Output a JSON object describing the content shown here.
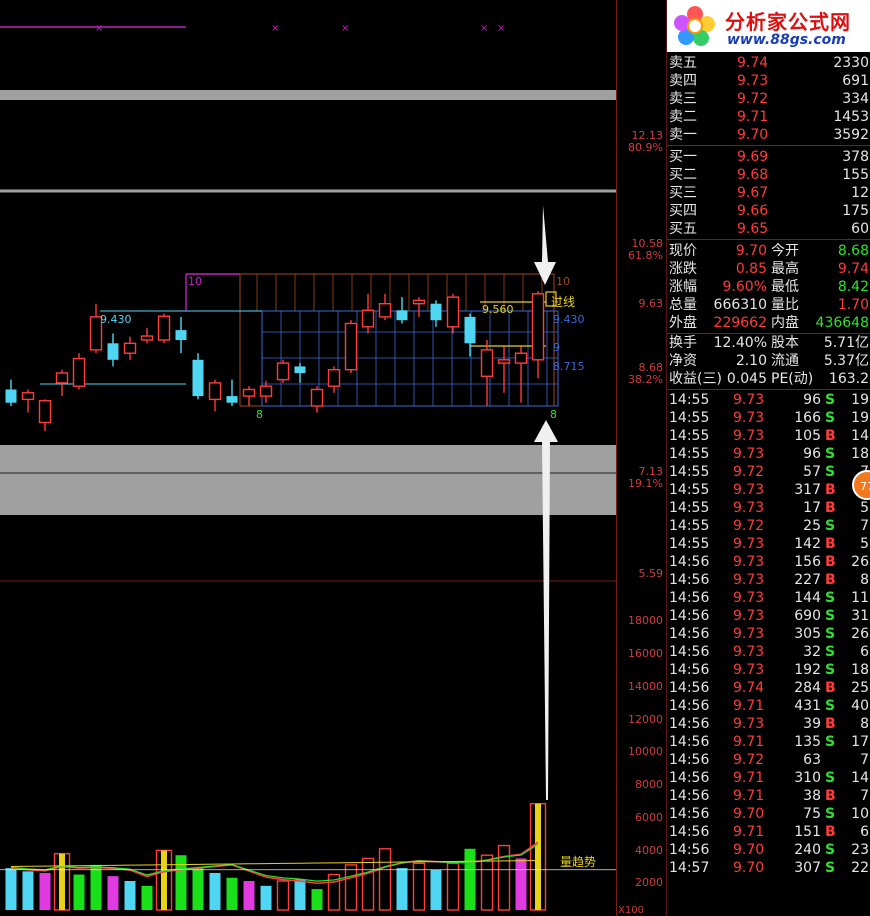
{
  "logo": {
    "brand": "分析家公式网",
    "url": "www.88gs.com"
  },
  "colors": {
    "up": "#ff3b3b",
    "down": "#4fd6f2",
    "grid": "#8a2a2a",
    "green_bar": "#19e019",
    "magenta_bar": "#e03ae0"
  },
  "price_axis": [
    {
      "value": "12.13",
      "pct": "80.9%"
    },
    {
      "value": "10.58",
      "pct": "61.8%"
    },
    {
      "value": "9.63",
      "pct": ""
    },
    {
      "value": "8.68",
      "pct": "38.2%"
    },
    {
      "value": "7.13",
      "pct": "19.1%"
    },
    {
      "value": "5.59",
      "pct": ""
    }
  ],
  "volume_axis": [
    "18000",
    "16000",
    "14000",
    "12000",
    "10000",
    "8000",
    "6000",
    "4000",
    "2000"
  ],
  "volume_unit": "X100",
  "annotations": {
    "box_top": "10",
    "box_bottom": "8",
    "level_9430": "9.430",
    "level_9560": "9.560",
    "level_9430_right": "9.430",
    "level_9": "9",
    "level_8715": "8.715",
    "box_right_top": "10",
    "box_right_bottom": "8",
    "signal_text": "过线",
    "volume_trend_text": "量趋势"
  },
  "order_book": {
    "asks": [
      {
        "label": "卖五",
        "price": "9.74",
        "vol": "2330"
      },
      {
        "label": "卖四",
        "price": "9.73",
        "vol": "691"
      },
      {
        "label": "卖三",
        "price": "9.72",
        "vol": "334"
      },
      {
        "label": "卖二",
        "price": "9.71",
        "vol": "1453"
      },
      {
        "label": "卖一",
        "price": "9.70",
        "vol": "3592"
      }
    ],
    "bids": [
      {
        "label": "买一",
        "price": "9.69",
        "vol": "378"
      },
      {
        "label": "买二",
        "price": "9.68",
        "vol": "155"
      },
      {
        "label": "买三",
        "price": "9.67",
        "vol": "12"
      },
      {
        "label": "买四",
        "price": "9.66",
        "vol": "175"
      },
      {
        "label": "买五",
        "price": "9.65",
        "vol": "60"
      }
    ]
  },
  "stats": [
    {
      "l1": "现价",
      "v1": "9.70",
      "c1": "red",
      "l2": "今开",
      "v2": "8.68",
      "c2": "green"
    },
    {
      "l1": "涨跌",
      "v1": "0.85",
      "c1": "red",
      "l2": "最高",
      "v2": "9.74",
      "c2": "red"
    },
    {
      "l1": "涨幅",
      "v1": "9.60%",
      "c1": "red",
      "l2": "最低",
      "v2": "8.42",
      "c2": "green"
    },
    {
      "l1": "总量",
      "v1": "666310",
      "c1": "white",
      "l2": "量比",
      "v2": "1.70",
      "c2": "red"
    },
    {
      "l1": "外盘",
      "v1": "229662",
      "c1": "red",
      "l2": "内盘",
      "v2": "436648",
      "c2": "green"
    },
    {
      "l1": "换手",
      "v1": "12.40%",
      "c1": "white",
      "l2": "股本",
      "v2": "5.71亿",
      "c2": "white"
    },
    {
      "l1": "净资",
      "v1": "2.10",
      "c1": "white",
      "l2": "流通",
      "v2": "5.37亿",
      "c2": "white"
    },
    {
      "l1": "收益(三)",
      "v1": "0.045",
      "c1": "white",
      "l2": "PE(动)",
      "v2": "163.2",
      "c2": "white"
    }
  ],
  "ticks": [
    {
      "t": "14:55",
      "p": "9.73",
      "v": "96",
      "d": "S",
      "n": "19"
    },
    {
      "t": "14:55",
      "p": "9.73",
      "v": "166",
      "d": "S",
      "n": "19"
    },
    {
      "t": "14:55",
      "p": "9.73",
      "v": "105",
      "d": "B",
      "n": "14"
    },
    {
      "t": "14:55",
      "p": "9.73",
      "v": "96",
      "d": "S",
      "n": "18"
    },
    {
      "t": "14:55",
      "p": "9.72",
      "v": "57",
      "d": "S",
      "n": "7"
    },
    {
      "t": "14:55",
      "p": "9.73",
      "v": "317",
      "d": "B",
      "n": "5"
    },
    {
      "t": "14:55",
      "p": "9.73",
      "v": "17",
      "d": "B",
      "n": "5"
    },
    {
      "t": "14:55",
      "p": "9.72",
      "v": "25",
      "d": "S",
      "n": "7"
    },
    {
      "t": "14:55",
      "p": "9.73",
      "v": "142",
      "d": "B",
      "n": "5"
    },
    {
      "t": "14:56",
      "p": "9.73",
      "v": "156",
      "d": "B",
      "n": "26"
    },
    {
      "t": "14:56",
      "p": "9.73",
      "v": "227",
      "d": "B",
      "n": "8"
    },
    {
      "t": "14:56",
      "p": "9.73",
      "v": "144",
      "d": "S",
      "n": "11"
    },
    {
      "t": "14:56",
      "p": "9.73",
      "v": "690",
      "d": "S",
      "n": "31",
      "vc": "mag"
    },
    {
      "t": "14:56",
      "p": "9.73",
      "v": "305",
      "d": "S",
      "n": "26"
    },
    {
      "t": "14:56",
      "p": "9.73",
      "v": "32",
      "d": "S",
      "n": "6"
    },
    {
      "t": "14:56",
      "p": "9.73",
      "v": "192",
      "d": "S",
      "n": "18"
    },
    {
      "t": "14:56",
      "p": "9.74",
      "v": "284",
      "d": "B",
      "n": "25"
    },
    {
      "t": "14:56",
      "p": "9.71",
      "v": "431",
      "d": "S",
      "n": "40"
    },
    {
      "t": "14:56",
      "p": "9.73",
      "v": "39",
      "d": "B",
      "n": "8"
    },
    {
      "t": "14:56",
      "p": "9.71",
      "v": "135",
      "d": "S",
      "n": "17"
    },
    {
      "t": "14:56",
      "p": "9.72",
      "v": "63",
      "d": "",
      "n": "7"
    },
    {
      "t": "14:56",
      "p": "9.71",
      "v": "310",
      "d": "S",
      "n": "14"
    },
    {
      "t": "14:56",
      "p": "9.71",
      "v": "38",
      "d": "B",
      "n": "7"
    },
    {
      "t": "14:56",
      "p": "9.70",
      "v": "75",
      "d": "S",
      "n": "10"
    },
    {
      "t": "14:56",
      "p": "9.71",
      "v": "151",
      "d": "B",
      "n": "6"
    },
    {
      "t": "14:56",
      "p": "9.70",
      "v": "240",
      "d": "S",
      "n": "23"
    },
    {
      "t": "14:57",
      "p": "9.70",
      "v": "307",
      "d": "S",
      "n": "22"
    }
  ],
  "chart_data": {
    "type": "candlestick",
    "candles": [
      {
        "o": 8.25,
        "h": 8.4,
        "l": 8.0,
        "c": 8.05
      },
      {
        "o": 8.1,
        "h": 8.25,
        "l": 7.9,
        "c": 8.2
      },
      {
        "o": 7.75,
        "h": 8.1,
        "l": 7.62,
        "c": 8.08
      },
      {
        "o": 8.35,
        "h": 8.55,
        "l": 8.15,
        "c": 8.5
      },
      {
        "o": 8.3,
        "h": 8.8,
        "l": 8.25,
        "c": 8.72
      },
      {
        "o": 8.85,
        "h": 9.55,
        "l": 8.8,
        "c": 9.35
      },
      {
        "o": 8.95,
        "h": 9.1,
        "l": 8.6,
        "c": 8.7
      },
      {
        "o": 8.8,
        "h": 9.05,
        "l": 8.7,
        "c": 8.95
      },
      {
        "o": 9.0,
        "h": 9.18,
        "l": 8.95,
        "c": 9.06
      },
      {
        "o": 9.0,
        "h": 9.4,
        "l": 8.95,
        "c": 9.36
      },
      {
        "o": 9.15,
        "h": 9.35,
        "l": 8.8,
        "c": 9.0
      },
      {
        "o": 8.7,
        "h": 8.8,
        "l": 8.1,
        "c": 8.15
      },
      {
        "o": 8.1,
        "h": 8.4,
        "l": 7.92,
        "c": 8.35
      },
      {
        "o": 8.15,
        "h": 8.4,
        "l": 8.0,
        "c": 8.05
      },
      {
        "o": 8.15,
        "h": 8.3,
        "l": 8.0,
        "c": 8.25
      },
      {
        "o": 8.15,
        "h": 8.38,
        "l": 8.05,
        "c": 8.3
      },
      {
        "o": 8.4,
        "h": 8.7,
        "l": 8.35,
        "c": 8.65
      },
      {
        "o": 8.6,
        "h": 8.65,
        "l": 8.35,
        "c": 8.5
      },
      {
        "o": 8.0,
        "h": 8.3,
        "l": 7.9,
        "c": 8.25
      },
      {
        "o": 8.3,
        "h": 8.6,
        "l": 8.2,
        "c": 8.55
      },
      {
        "o": 8.55,
        "h": 9.3,
        "l": 8.5,
        "c": 9.25
      },
      {
        "o": 9.2,
        "h": 9.7,
        "l": 9.1,
        "c": 9.45
      },
      {
        "o": 9.35,
        "h": 9.7,
        "l": 9.3,
        "c": 9.55
      },
      {
        "o": 9.45,
        "h": 9.65,
        "l": 9.25,
        "c": 9.3
      },
      {
        "o": 9.55,
        "h": 9.65,
        "l": 9.35,
        "c": 9.6
      },
      {
        "o": 9.55,
        "h": 9.6,
        "l": 9.2,
        "c": 9.3
      },
      {
        "o": 9.2,
        "h": 9.7,
        "l": 9.1,
        "c": 9.65
      },
      {
        "o": 9.35,
        "h": 9.4,
        "l": 8.75,
        "c": 8.95
      },
      {
        "o": 8.45,
        "h": 9.0,
        "l": 8.0,
        "c": 8.85
      },
      {
        "o": 8.65,
        "h": 8.9,
        "l": 8.2,
        "c": 8.7
      },
      {
        "o": 8.65,
        "h": 8.9,
        "l": 8.05,
        "c": 8.8
      },
      {
        "o": 8.7,
        "h": 9.74,
        "l": 8.42,
        "c": 9.7
      }
    ],
    "volumes": [
      {
        "v": 2600,
        "up": false,
        "style": "cyan"
      },
      {
        "v": 2400,
        "up": false,
        "style": "cyan"
      },
      {
        "v": 2300,
        "up": true,
        "style": "magenta"
      },
      {
        "v": 3500,
        "up": true,
        "style": "yellowframe"
      },
      {
        "v": 2200,
        "up": false,
        "style": "green"
      },
      {
        "v": 2800,
        "up": false,
        "style": "green"
      },
      {
        "v": 2100,
        "up": true,
        "style": "magenta"
      },
      {
        "v": 1800,
        "up": false,
        "style": "cyan"
      },
      {
        "v": 1500,
        "up": false,
        "style": "green"
      },
      {
        "v": 3700,
        "up": true,
        "style": "yellowframe"
      },
      {
        "v": 3400,
        "up": false,
        "style": "green"
      },
      {
        "v": 2600,
        "up": false,
        "style": "green"
      },
      {
        "v": 2300,
        "up": false,
        "style": "cyan"
      },
      {
        "v": 2000,
        "up": false,
        "style": "green"
      },
      {
        "v": 1800,
        "up": true,
        "style": "magenta"
      },
      {
        "v": 1500,
        "up": false,
        "style": "cyan"
      },
      {
        "v": 1800,
        "up": true,
        "style": "red"
      },
      {
        "v": 1900,
        "up": false,
        "style": "cyan"
      },
      {
        "v": 1300,
        "up": false,
        "style": "green"
      },
      {
        "v": 2200,
        "up": true,
        "style": "red"
      },
      {
        "v": 2800,
        "up": true,
        "style": "red"
      },
      {
        "v": 3200,
        "up": true,
        "style": "red"
      },
      {
        "v": 3800,
        "up": true,
        "style": "red"
      },
      {
        "v": 2600,
        "up": false,
        "style": "cyan"
      },
      {
        "v": 2900,
        "up": true,
        "style": "red"
      },
      {
        "v": 2500,
        "up": false,
        "style": "cyan"
      },
      {
        "v": 2900,
        "up": true,
        "style": "red"
      },
      {
        "v": 3800,
        "up": false,
        "style": "green"
      },
      {
        "v": 3400,
        "up": true,
        "style": "red"
      },
      {
        "v": 4000,
        "up": true,
        "style": "red"
      },
      {
        "v": 3200,
        "up": true,
        "style": "magenta"
      },
      {
        "v": 6600,
        "up": true,
        "style": "yellowframe"
      }
    ]
  }
}
